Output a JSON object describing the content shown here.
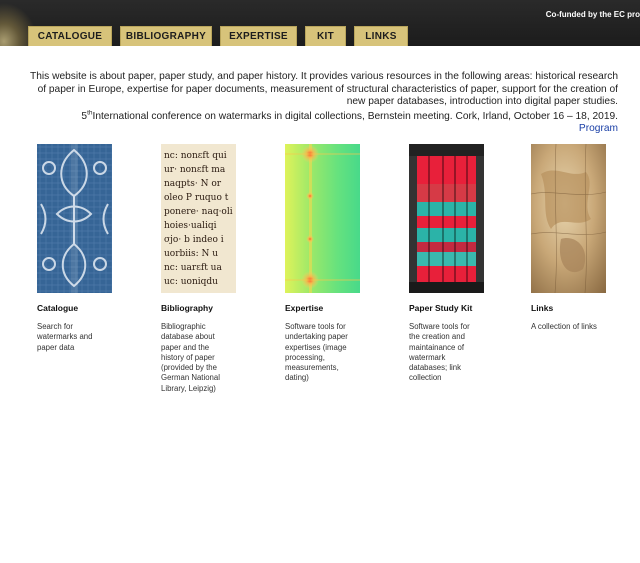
{
  "header": {
    "cofunded_text": "Co-funded by the EC pro"
  },
  "nav": {
    "items": [
      {
        "label": "CATALOGUE"
      },
      {
        "label": "BIBLIOGRAPHY"
      },
      {
        "label": "EXPERTISE"
      },
      {
        "label": "KIT"
      },
      {
        "label": "LINKS"
      }
    ]
  },
  "intro": {
    "text": "This website is about paper, paper study, and paper history. It provides various resources in the following areas: historical research of paper in Europe, expertise for paper documents, measurement of structural characteristics of paper, support for the creation of new paper databases, introduction into digital paper studies."
  },
  "conference": {
    "ordinal_number": "5",
    "ordinal_suffix": "th",
    "text": "International conference on watermarks in digital collections, Bernstein meeting. Cork, Irland, October 16 – 18, 2019.",
    "program_link": "Program"
  },
  "columns": [
    {
      "title": "Catalogue",
      "description": "Search for watermarks and paper data"
    },
    {
      "title": "Bibliography",
      "description": "Bibliographic database about paper and the history of paper (provided by the German National Library, Leipzig)"
    },
    {
      "title": "Expertise",
      "description": "Software tools for undertaking paper expertises (image processing, measurements, dating)"
    },
    {
      "title": "Paper Study Kit",
      "description": "Software tools for the creation and maintainance of watermark databases; link collection"
    },
    {
      "title": "Links",
      "description": "A collection of links"
    }
  ],
  "manuscript_lines": [
    "nc: nonεft qui",
    "ur· nonεft ma",
    "naqpts·  N  or",
    "oleo P ruquo t",
    "ponere· naq·oli",
    "hoies·ualiqi",
    "σjo· b indeo i",
    "uorbiis: N  u",
    "nc: uarεft ua",
    "uc: uoniqdu"
  ],
  "colors": {
    "nav_bg": "#d7c37a",
    "link": "#1a3fa6",
    "topbar": "#1f1f1f"
  }
}
